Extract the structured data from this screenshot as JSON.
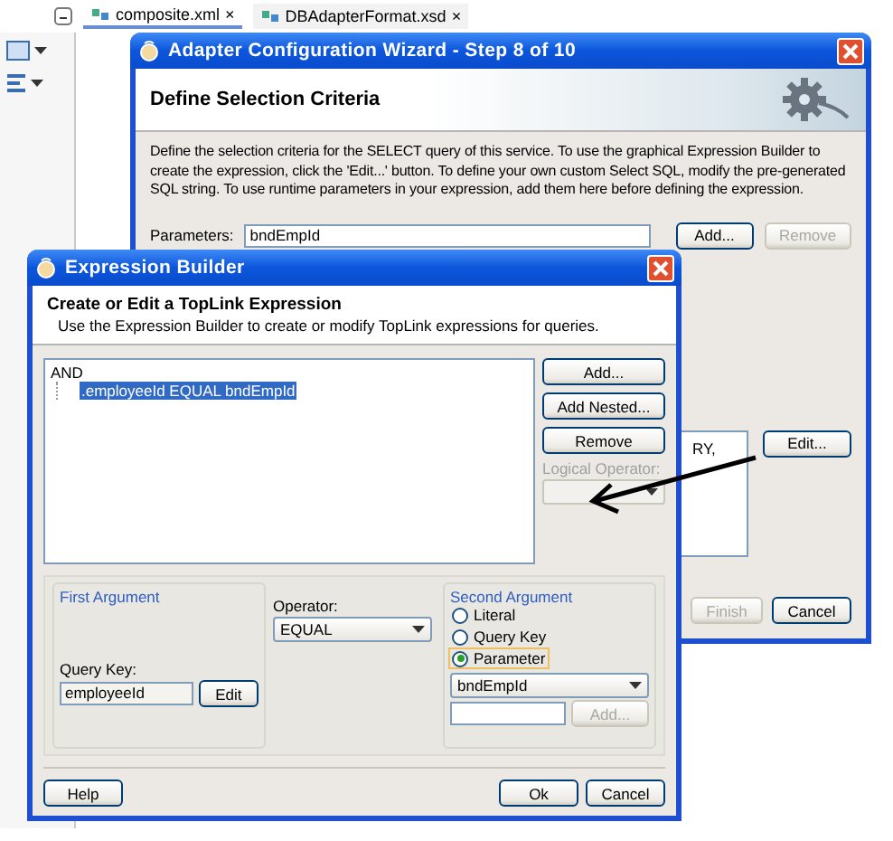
{
  "ide": {
    "tabs": [
      {
        "label": "composite.xml",
        "close": "×",
        "selected": true
      },
      {
        "label": "DBAdapterFormat.xsd",
        "close": "×",
        "selected": false
      }
    ]
  },
  "wizard": {
    "title": "Adapter Configuration Wizard - Step 8 of 10",
    "header": "Define Selection Criteria",
    "description": "Define the selection criteria for the SELECT query of this service.  To use the graphical Expression Builder to create the expression, click the 'Edit...' button.  To define your own custom Select SQL, modify the pre-generated SQL string.  To use runtime parameters in your expression, add them here before defining the expression.",
    "parameters_label": "Parameters:",
    "parameters_value": "bndEmpId",
    "parameter_buttons": [
      {
        "label": "Add...",
        "disabled": false
      },
      {
        "label": "Remove",
        "disabled": true
      }
    ],
    "query_text": "RY,",
    "edit_button": "Edit...",
    "footer_buttons": [
      {
        "label": "Finish",
        "disabled": true
      },
      {
        "label": "Cancel",
        "disabled": false
      }
    ]
  },
  "builder": {
    "title": "Expression Builder",
    "heading": "Create or Edit a TopLink Expression",
    "subtitle": "Use the Expression Builder to create or modify TopLink expressions for queries.",
    "tree": {
      "label": "AND",
      "children": [
        {
          "label": ".employeeId EQUAL bndEmpId",
          "selected": true
        }
      ]
    },
    "side_buttons": [
      {
        "label": "Add...",
        "disabled": false
      },
      {
        "label": "Add Nested...",
        "disabled": false
      },
      {
        "label": "Remove",
        "disabled": false
      }
    ],
    "logical_operator": {
      "label": "Logical Operator:",
      "disabled": true
    },
    "first_argument": {
      "title": "First Argument",
      "query_key_label": "Query Key:",
      "query_key_value": "employeeId",
      "edit_button": "Edit"
    },
    "operator": {
      "label": "Operator:",
      "value": "EQUAL"
    },
    "second_argument": {
      "title": "Second Argument",
      "options": [
        {
          "label": "Literal",
          "selected": false
        },
        {
          "label": "Query Key",
          "selected": false
        },
        {
          "label": "Parameter",
          "selected": true
        }
      ],
      "parameter_value": "bndEmpId",
      "add_button": {
        "label": "Add...",
        "disabled": true
      }
    },
    "footer": {
      "help": "Help",
      "ok": "Ok",
      "cancel": "Cancel"
    }
  }
}
